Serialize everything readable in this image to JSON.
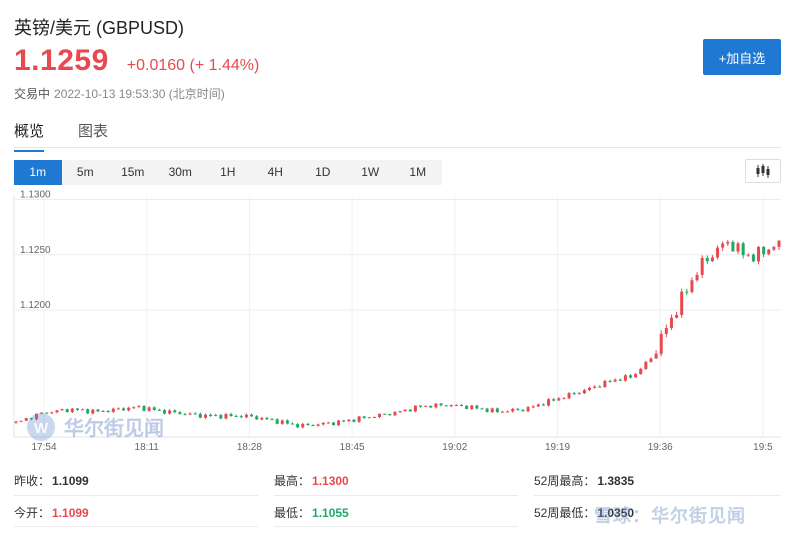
{
  "header": {
    "title": "英镑/美元  (GBPUSD)",
    "price": "1.1259",
    "change": "+0.0160 (+ 1.44%)",
    "status": "交易中",
    "timestamp": "2022-10-13 19:53:30 (北京时间)",
    "watch_button": "+加自选"
  },
  "tabs": [
    "概览",
    "图表"
  ],
  "periods": [
    "1m",
    "5m",
    "15m",
    "30m",
    "1H",
    "4H",
    "1D",
    "1W",
    "1M"
  ],
  "active_period": "1m",
  "chart_data": {
    "type": "candlestick",
    "x_ticks": [
      "17:54",
      "18:11",
      "18:28",
      "18:45",
      "19:02",
      "19:19",
      "19:36",
      "19:5"
    ],
    "y_ticks": [
      "1.1300",
      "1.1250",
      "1.1200"
    ],
    "ylim": [
      1.1085,
      1.1305
    ],
    "up_color": "#e8494f",
    "down_color": "#1fa866",
    "grid": true
  },
  "stats": {
    "prev_close_label": "昨收：",
    "prev_close": "1.1099",
    "open_label": "今开：",
    "open": "1.1099",
    "high_label": "最高：",
    "high": "1.1300",
    "low_label": "最低：",
    "low": "1.1055",
    "w52_high_label": "52周最高：",
    "w52_high": "1.3835",
    "w52_low_label": "52周最低：",
    "w52_low": "1.0350"
  },
  "watermarks": [
    "华尔街见闻",
    "雪球：华尔街见闻"
  ]
}
